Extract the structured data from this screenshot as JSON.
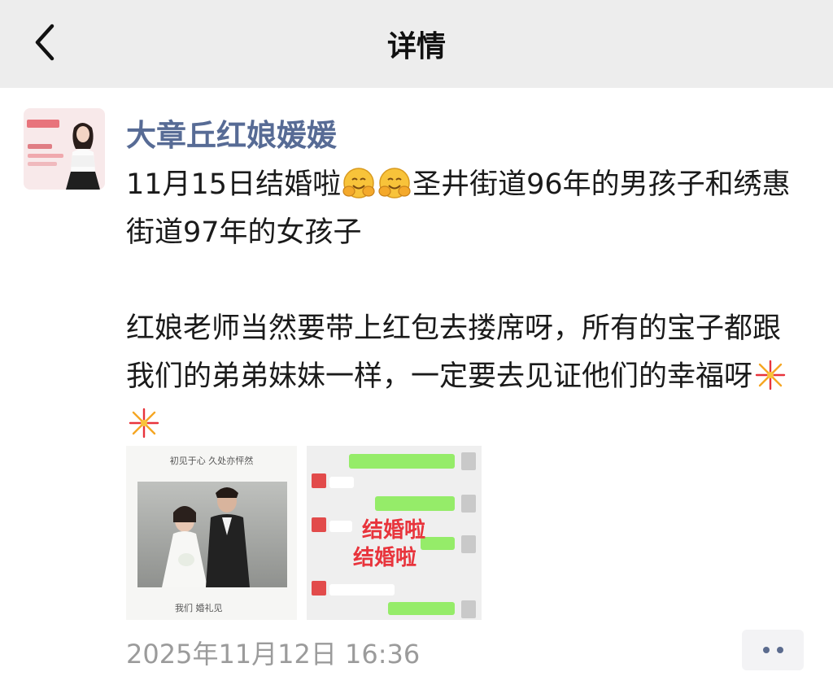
{
  "nav": {
    "title": "详情",
    "back_icon": "chevron-left-icon"
  },
  "author": {
    "name": "大章丘红娘媛媛"
  },
  "post": {
    "paragraph1_a": "11月15日结婚啦",
    "paragraph1_b": "圣井街道96年的男孩子和绣惠街道97年的女孩子",
    "paragraph2": "红娘老师当然要带上红包去搂席呀，所有的宝子都跟我们的弟弟妹妹一样，一定要去见证他们的幸福呀",
    "emoji_1": "hugging-face-emoji",
    "emoji_2": "fireworks-emoji"
  },
  "images": {
    "photo1": {
      "handwriting_top": "初见于心 久处亦怦然",
      "handwriting_bottom": "我们 婚礼见"
    },
    "photo2": {
      "overlay_line1": "结婚啦",
      "overlay_line2": "结婚啦"
    }
  },
  "timestamp": "2025年11月12日 16:36",
  "colors": {
    "nav_bg": "#ededed",
    "name": "#576b95",
    "timestamp": "#9b9b9b",
    "overlay_text": "#e8343c"
  }
}
